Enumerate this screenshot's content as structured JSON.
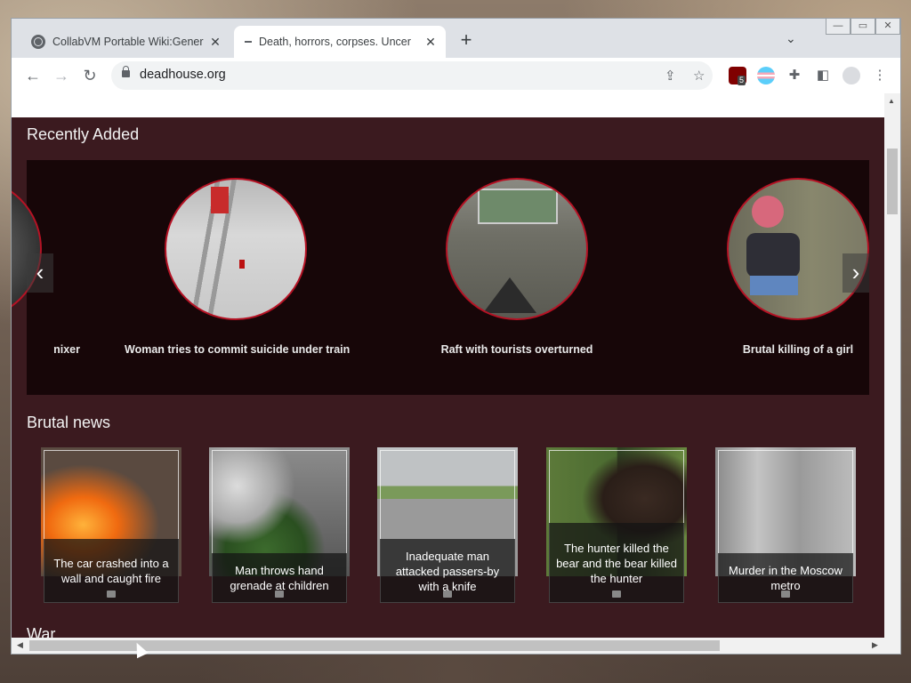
{
  "browser": {
    "tabs": [
      {
        "title": "CollabVM Portable Wiki:Gener",
        "icon": "globe-icon",
        "close": "✕"
      },
      {
        "title": "Death, horrors, corpses. Uncer",
        "icon": "loading-icon",
        "close": "✕"
      }
    ],
    "new_tab": "+",
    "tab_list": "⌄",
    "window_buttons": [
      "—",
      "▭",
      "✕"
    ],
    "nav": {
      "back": "←",
      "forward": "→",
      "reload": "↻"
    },
    "url": "deadhouse.org",
    "omnibox_icons": {
      "share": "⇪",
      "bookmark": "☆"
    },
    "extensions": {
      "ublock_badge": "5",
      "puzzle": "✚",
      "sidepanel": "◧",
      "menu": "⋮"
    }
  },
  "page": {
    "recently_added_title": "Recently Added",
    "carousel": {
      "prev": "‹",
      "next": "›",
      "items": [
        {
          "caption": "nixer"
        },
        {
          "caption": "Woman tries to commit suicide under train"
        },
        {
          "caption": "Raft with tourists overturned"
        },
        {
          "caption": "Brutal killing of a girl"
        }
      ]
    },
    "brutal_news_title": "Brutal news",
    "news": [
      {
        "caption": "The car crashed into a wall and caught fire"
      },
      {
        "caption": "Man throws hand grenade at children"
      },
      {
        "caption": "Inadequate man attacked passers-by with a knife"
      },
      {
        "caption": "The hunter killed the bear and the bear killed the hunter"
      },
      {
        "caption": "Murder in the Moscow metro"
      }
    ],
    "war_title": "War"
  },
  "colors": {
    "page_bg": "#3b1a1f",
    "carousel_bg": "#170608",
    "circle_border": "#b51224"
  }
}
